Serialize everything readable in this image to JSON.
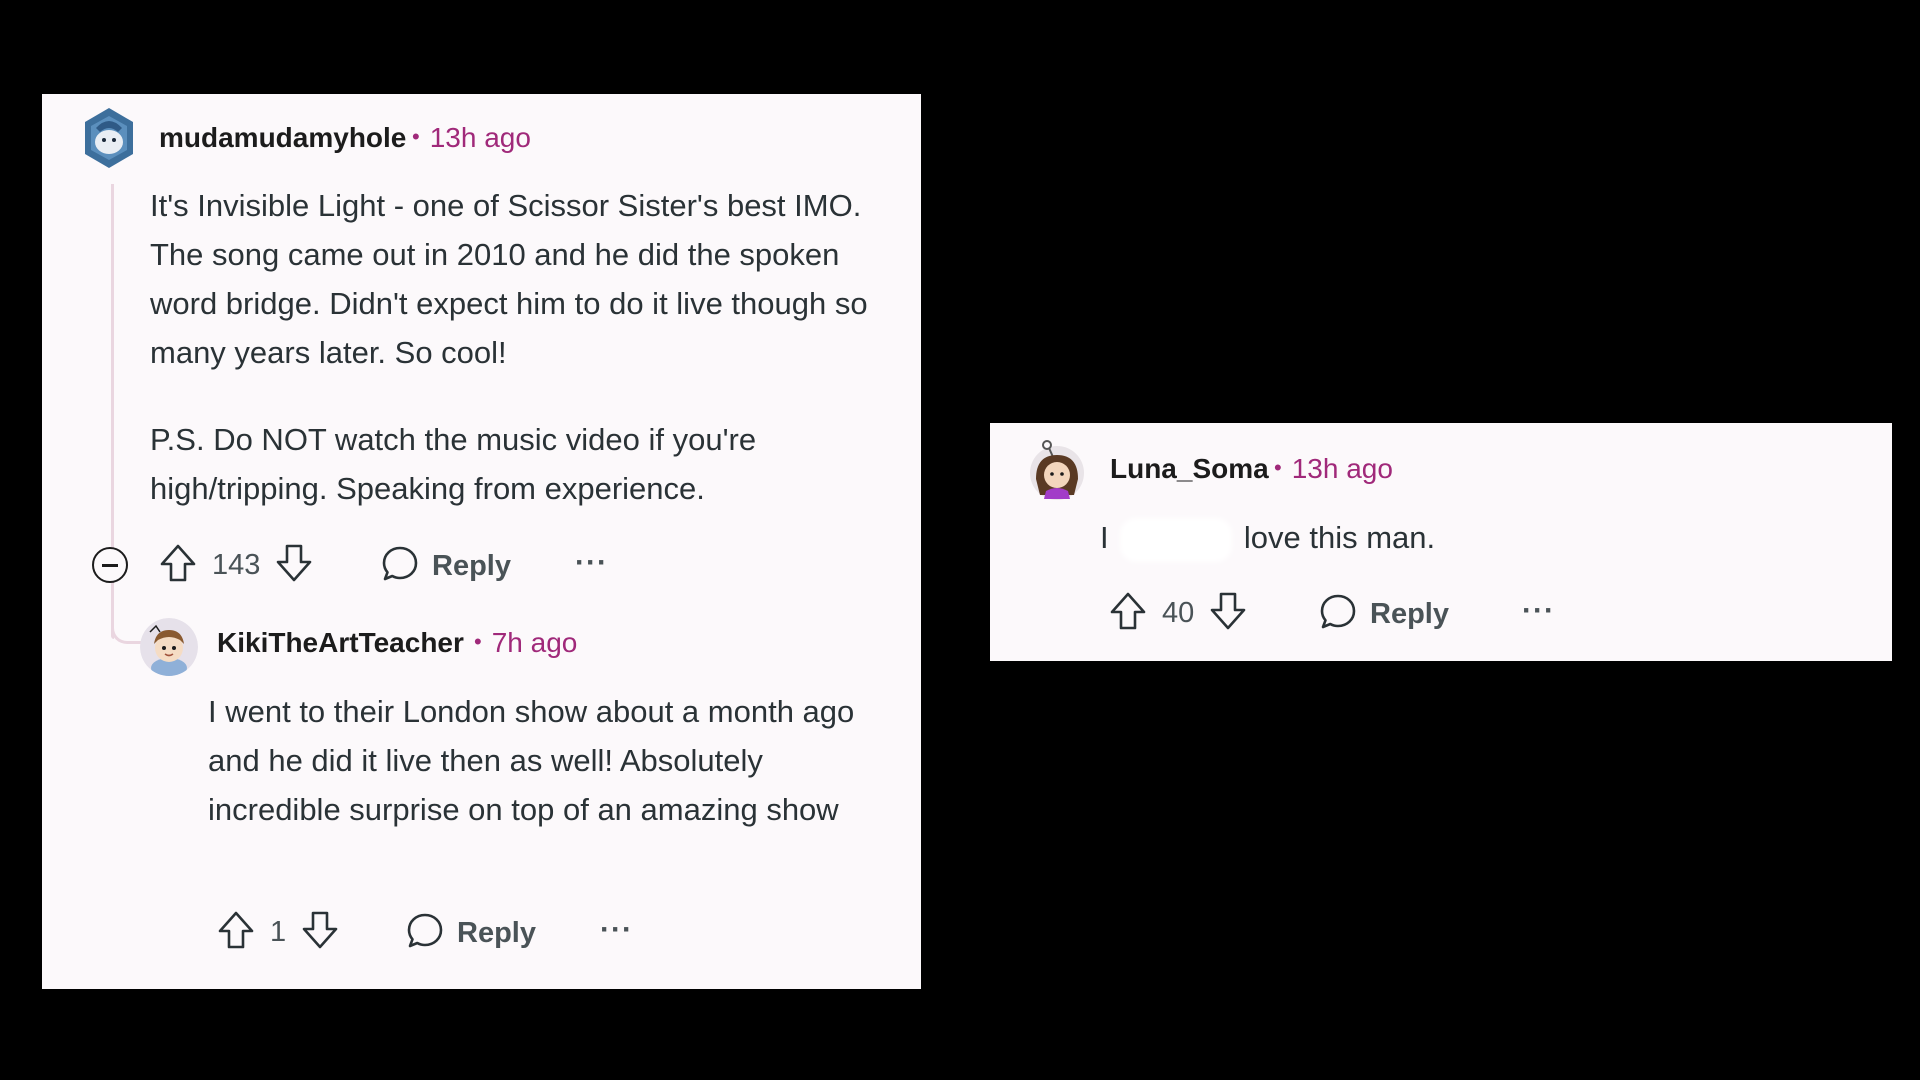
{
  "comments": {
    "main": {
      "username": "mudamudamyhole",
      "time": "13h ago",
      "paragraphs": [
        "It's Invisible Light - one of Scissor Sister's best IMO. The song came out in 2010 and he did the spoken word bridge. Didn't expect him to do it live though so many years later. So cool!",
        "P.S. Do NOT watch the music video if you're high/tripping. Speaking from experience."
      ],
      "votes": "143",
      "reply_label": "Reply",
      "more_label": "···"
    },
    "reply": {
      "username": "KikiTheArtTeacher",
      "time": "7h ago",
      "text": "I went to their London show about a month ago and he did it live then as well! Absolutely incredible surprise on top of an amazing show",
      "votes": "1",
      "reply_label": "Reply",
      "more_label": "···"
    },
    "right": {
      "username": "Luna_Soma",
      "time": "13h ago",
      "text_before": "I",
      "text_after": "love this man.",
      "votes": "40",
      "reply_label": "Reply",
      "more_label": "···"
    }
  },
  "colors": {
    "background": "#000000",
    "panel": "#fcf9fb",
    "timestamp": "#a0297a",
    "text": "#2a3236"
  },
  "icons": [
    "upvote-icon",
    "downvote-icon",
    "comment-icon",
    "collapse-icon",
    "more-icon"
  ]
}
